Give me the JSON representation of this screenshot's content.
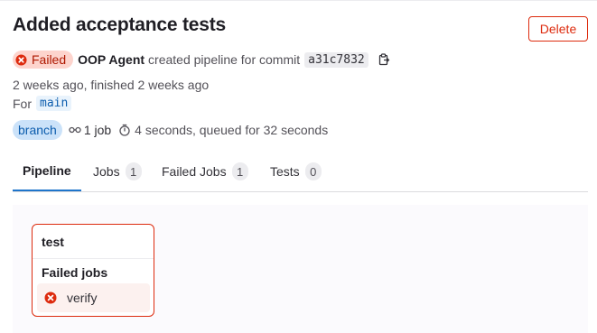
{
  "header": {
    "title": "Added acceptance tests",
    "delete_label": "Delete"
  },
  "pipeline_info": {
    "status_label": "Failed",
    "author": "OOP Agent",
    "action_text": "created pipeline for commit",
    "commit_sha": "a31c7832",
    "timing_text": "2 weeks ago, finished 2 weeks ago",
    "for_label": "For",
    "ref": "main",
    "branch_badge": "branch",
    "jobs_label": "1 job",
    "duration_text": "4 seconds, queued for 32 seconds"
  },
  "tabs": [
    {
      "label": "Pipeline",
      "count": ""
    },
    {
      "label": "Jobs",
      "count": "1"
    },
    {
      "label": "Failed Jobs",
      "count": "1"
    },
    {
      "label": "Tests",
      "count": "0"
    }
  ],
  "stage": {
    "name": "test",
    "group_title": "Failed jobs",
    "jobs": [
      {
        "name": "verify",
        "status": "failed"
      }
    ]
  },
  "colors": {
    "failed": "#dd2b0e",
    "failed_bg": "#fdd4cd",
    "branch_bg": "#cbe2f9",
    "active_tab": "#1f75cb"
  },
  "icons": {
    "status": "status-failed-icon",
    "copy": "clipboard-icon",
    "pipeline": "pipeline-icon",
    "timer": "timer-icon"
  }
}
